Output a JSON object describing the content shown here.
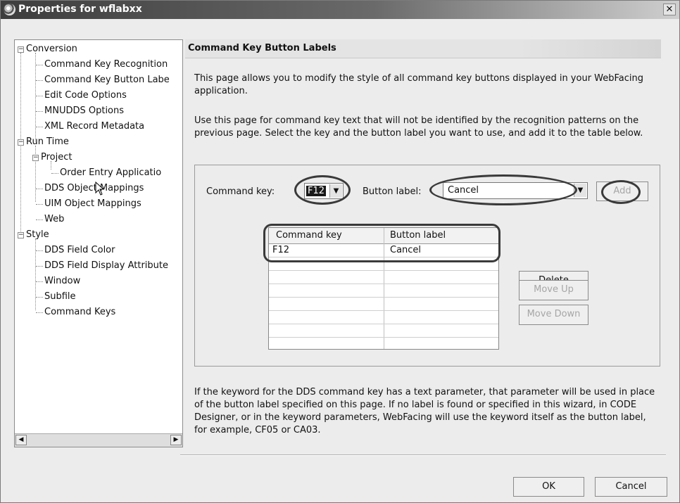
{
  "window": {
    "title": "Properties for wflabxx"
  },
  "tree": {
    "nodes": [
      {
        "label": "Conversion"
      },
      {
        "label": "Command Key Recognition"
      },
      {
        "label": "Command Key Button Labe"
      },
      {
        "label": "Edit Code Options"
      },
      {
        "label": "MNUDDS Options"
      },
      {
        "label": "XML Record Metadata"
      },
      {
        "label": "Run Time"
      },
      {
        "label": "Project"
      },
      {
        "label": "Order Entry Applicatio"
      },
      {
        "label": "DDS Object Mappings"
      },
      {
        "label": "UIM Object Mappings"
      },
      {
        "label": "Web"
      },
      {
        "label": "Style"
      },
      {
        "label": "DDS Field Color"
      },
      {
        "label": "DDS Field Display Attribute"
      },
      {
        "label": "Window"
      },
      {
        "label": "Subfile"
      },
      {
        "label": "Command Keys"
      }
    ]
  },
  "page": {
    "title": "Command Key Button Labels",
    "intro_line1": "This page allows you to modify the style of all command key buttons displayed in your WebFacing",
    "intro_line2": "application.",
    "usage_line1": "Use this page for command key text that will not be identified by the recognition patterns on the",
    "usage_line2": "previous page.  Select the key and the button label you want to use, and add it to the table below.",
    "note_line1": "If the keyword for the DDS command key has a text parameter, that parameter will be used in place",
    "note_line2": "of the button label specified on this page.  If no label is found or specified in this wizard, in CODE",
    "note_line3": "Designer, or in the keyword parameters, WebFacing will use the keyword itself as the button label,",
    "note_line4": "for example, CF05 or CA03."
  },
  "form": {
    "command_key_label": "Command key:",
    "command_key_value": "F12",
    "button_label_label": "Button label:",
    "button_label_value": "Cancel",
    "add_button": "Add"
  },
  "table": {
    "headers": [
      "Command key",
      "Button label"
    ],
    "rows": [
      [
        "F12",
        "Cancel"
      ]
    ]
  },
  "side_buttons": {
    "delete": "Delete",
    "move_up": "Move Up",
    "move_down": "Move Down"
  },
  "footer": {
    "ok": "OK",
    "cancel": "Cancel"
  }
}
